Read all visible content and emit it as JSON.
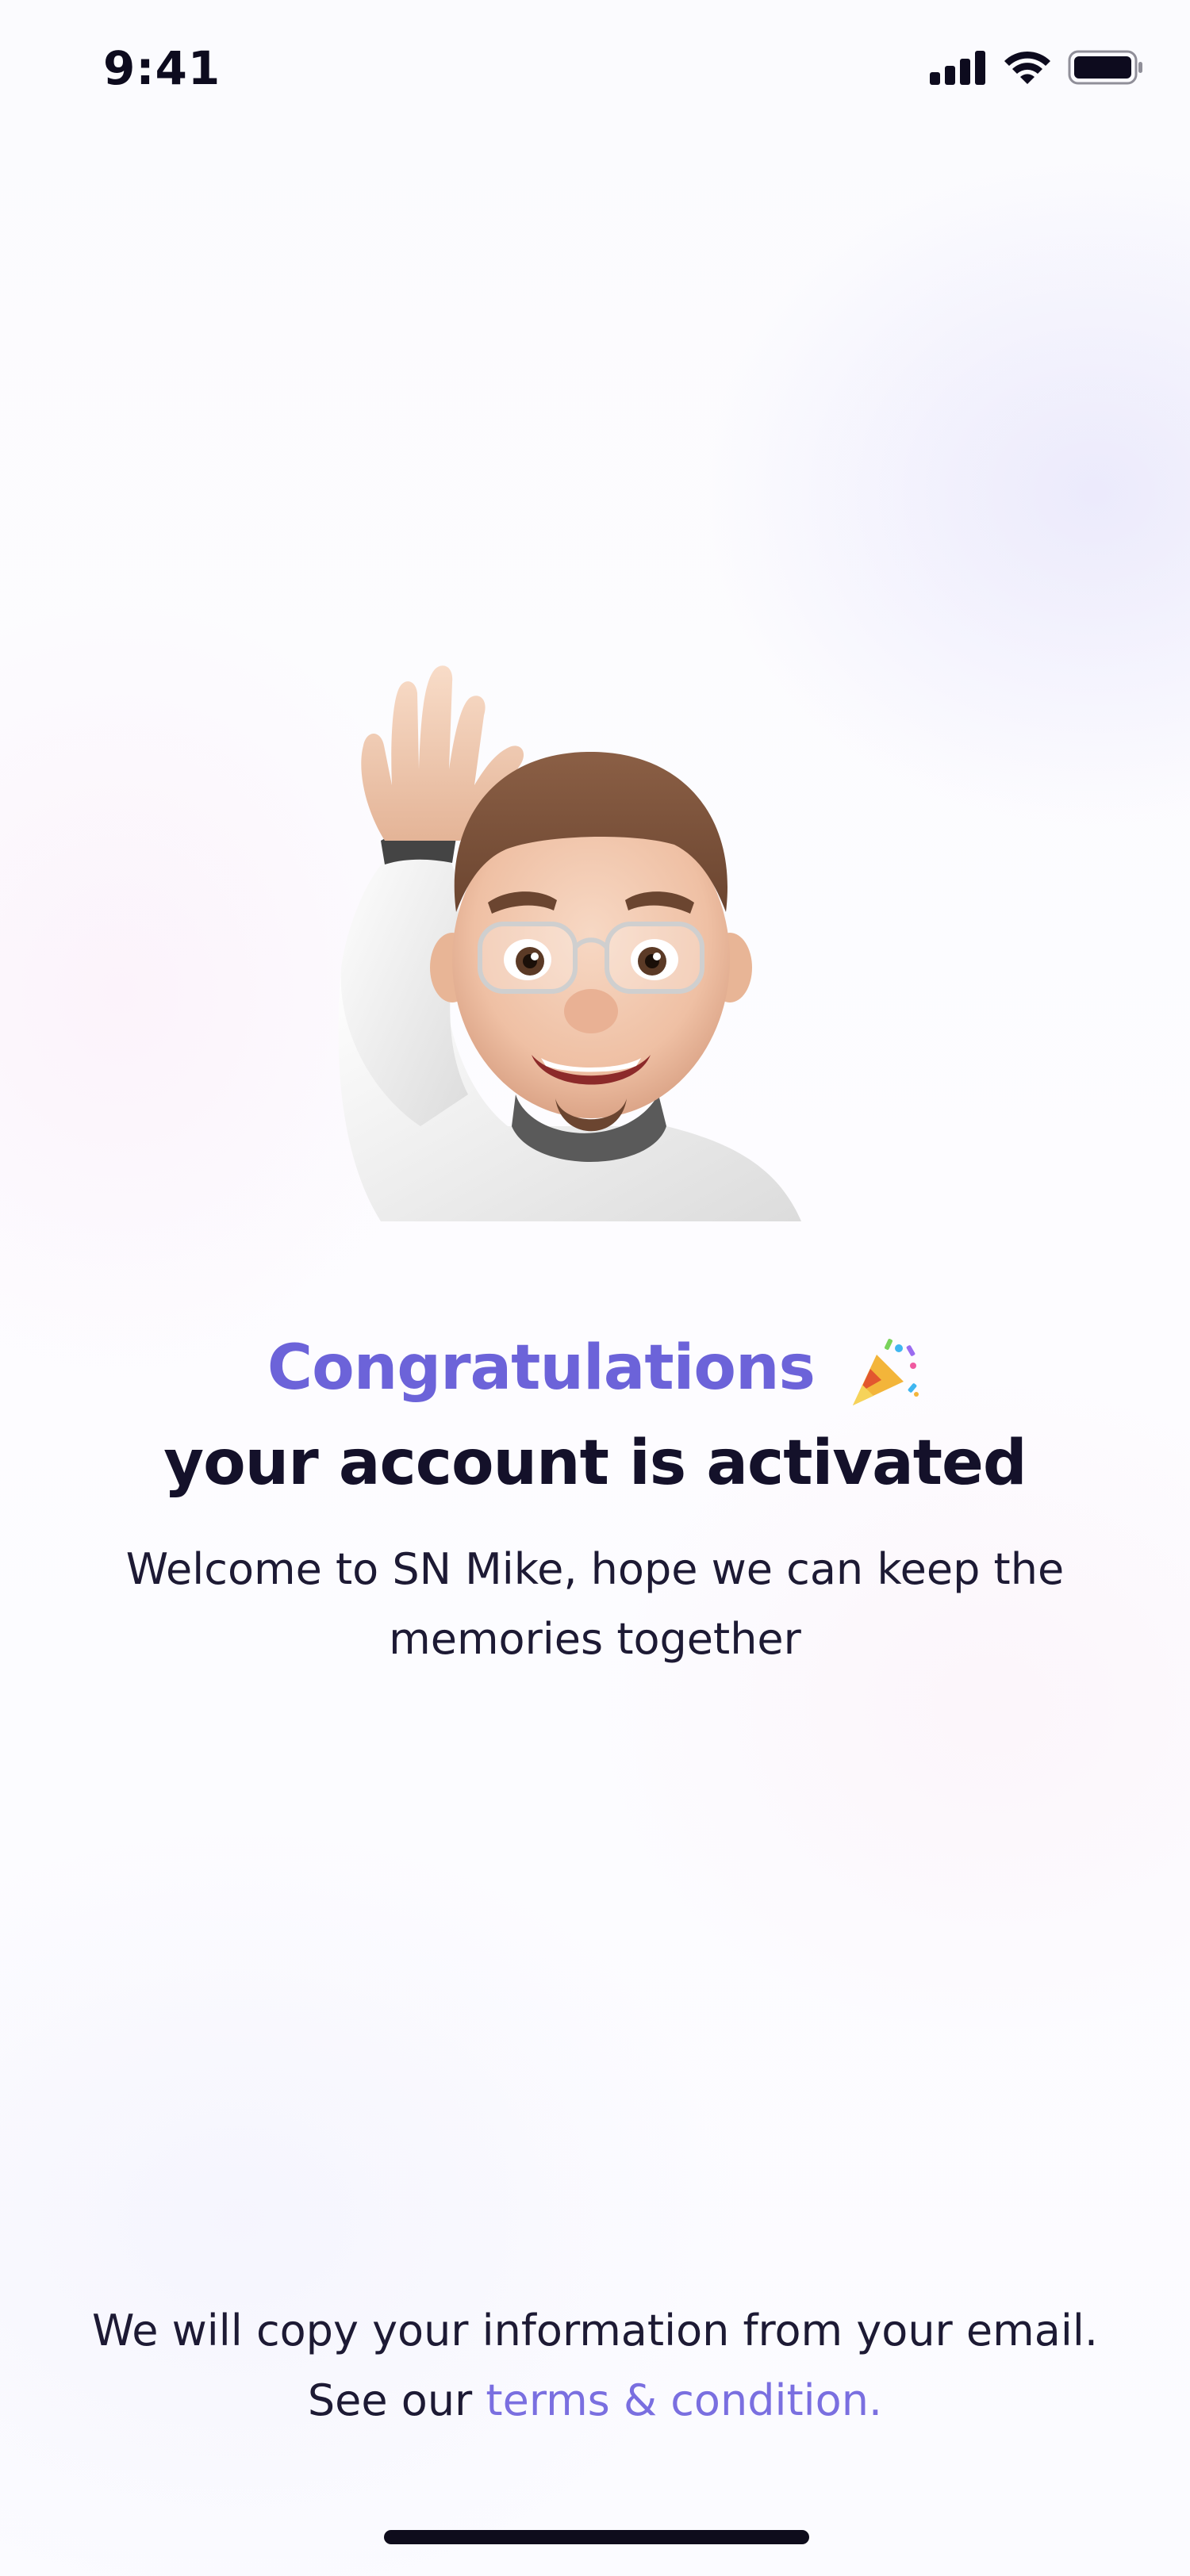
{
  "status_bar": {
    "time": "9:41",
    "icons": [
      "cellular-signal-icon",
      "wifi-icon",
      "battery-icon"
    ]
  },
  "hero": {
    "image": "memoji-waving-icon"
  },
  "content": {
    "congrats": "Congratulations",
    "congrats_emoji": "party-popper-icon",
    "headline": "your account is activated",
    "subtitle": "Welcome to SN Mike, hope we can keep the memories together"
  },
  "footer": {
    "line1": "We will copy your information from your email.",
    "line2_prefix": "See our ",
    "link_text": "terms & condition."
  },
  "colors": {
    "accent": "#6c63d9",
    "text": "#14112a",
    "link": "#7a6fe0"
  }
}
